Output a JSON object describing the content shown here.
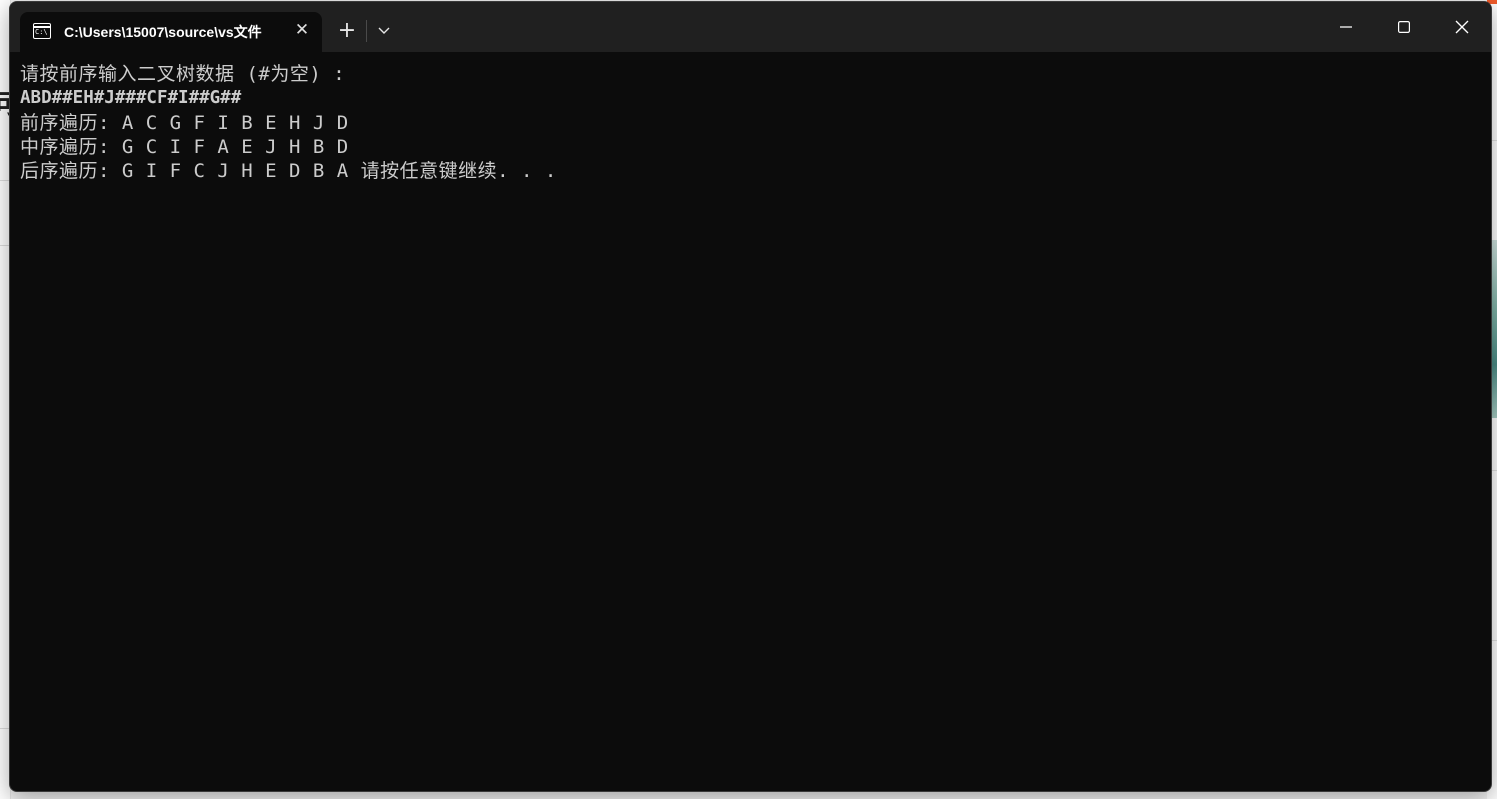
{
  "window": {
    "tab_title": "C:\\Users\\15007\\source\\vs文件",
    "tab_icon_text": "C:\\",
    "close_tab_glyph": "✕",
    "new_tab_glyph": "+"
  },
  "console": {
    "lines": [
      "请按前序输入二叉树数据 (#为空) :",
      "ABD##EH#J###CF#I##G##",
      "前序遍历: A C G F I B E H J D",
      "中序遍历: G C I F A E J H B D",
      "后序遍历: G I F C J H E D B A 请按任意键继续. . ."
    ]
  },
  "colors": {
    "console_bg": "#0c0c0c",
    "titlebar_bg": "#202020",
    "text": "#cccccc"
  }
}
